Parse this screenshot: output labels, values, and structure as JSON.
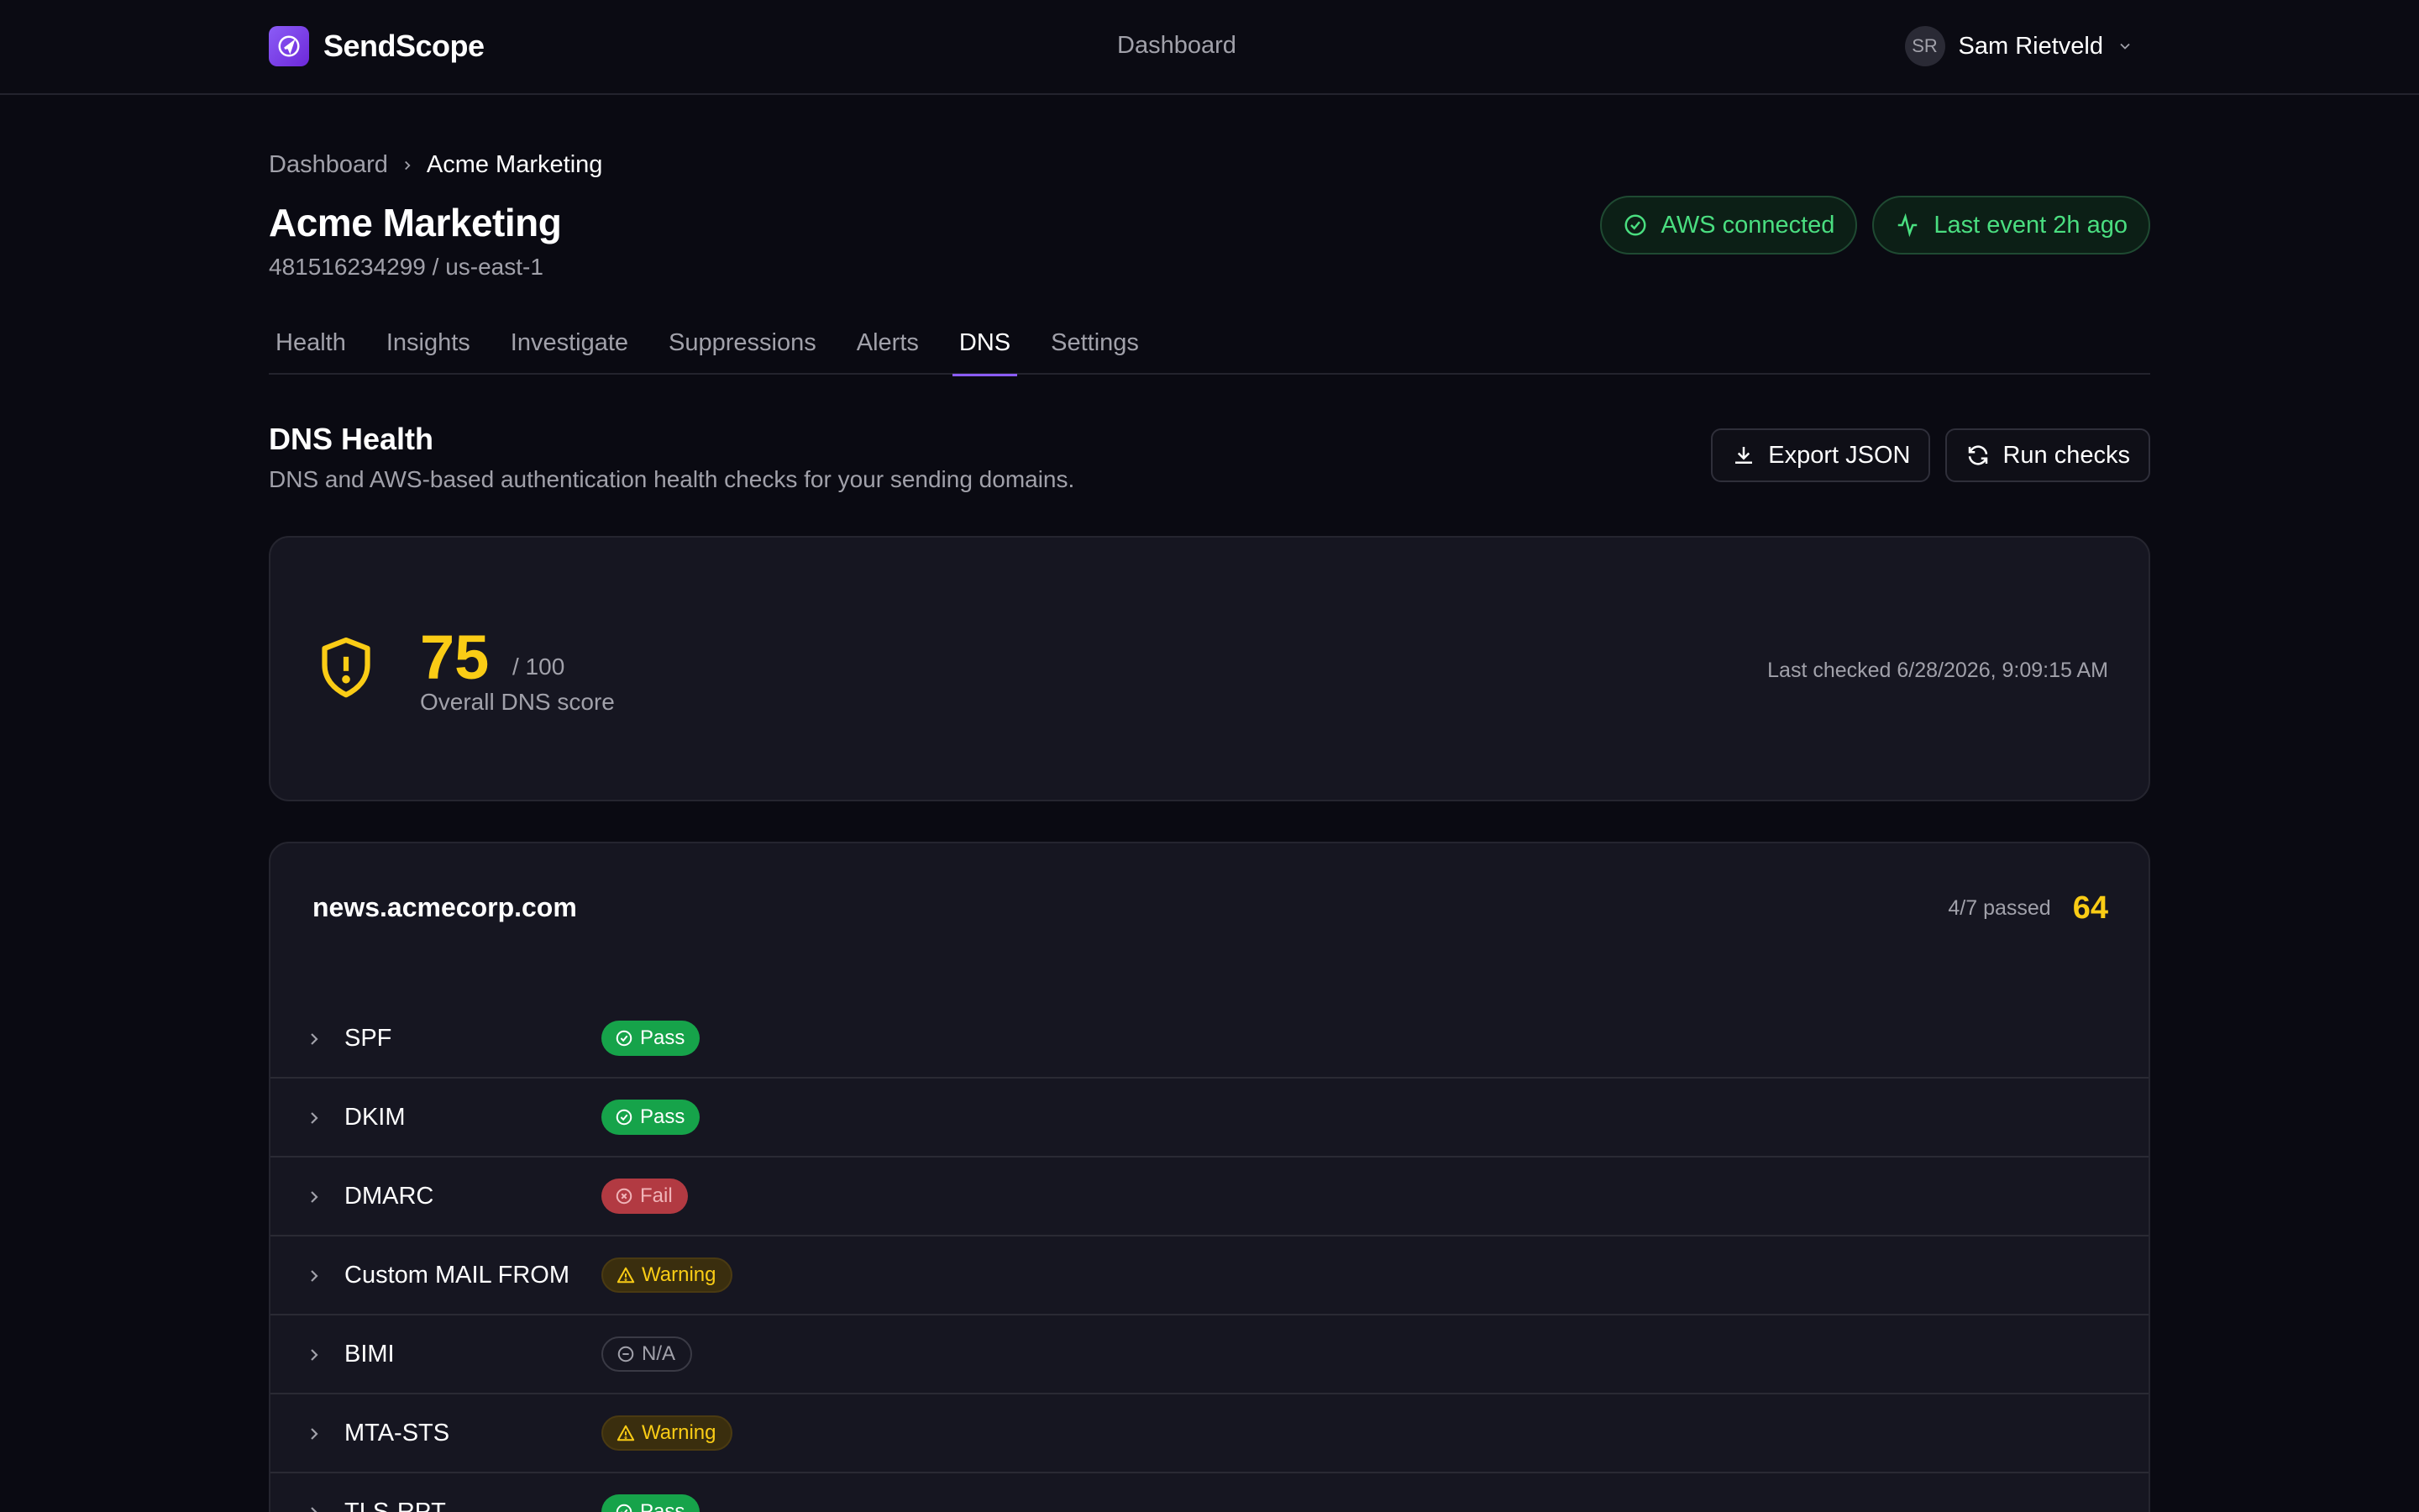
{
  "app": {
    "name": "SendScope",
    "nav_center": "Dashboard"
  },
  "user": {
    "initials": "SR",
    "name": "Sam Rietveld"
  },
  "breadcrumb": {
    "root": "Dashboard",
    "current": "Acme Marketing"
  },
  "account": {
    "title": "Acme Marketing",
    "subtitle": "481516234299 / us-east-1"
  },
  "badges": {
    "aws": "AWS connected",
    "last_event": "Last event 2h ago"
  },
  "tabs": [
    {
      "label": "Health"
    },
    {
      "label": "Insights"
    },
    {
      "label": "Investigate"
    },
    {
      "label": "Suppressions"
    },
    {
      "label": "Alerts"
    },
    {
      "label": "DNS",
      "active": true
    },
    {
      "label": "Settings"
    }
  ],
  "section": {
    "title": "DNS Health",
    "subtitle": "DNS and AWS-based authentication health checks for your sending domains.",
    "export_label": "Export JSON",
    "run_label": "Run checks"
  },
  "score": {
    "value": "75",
    "max": "/ 100",
    "label": "Overall DNS score",
    "last_checked": "Last checked 6/28/2026, 9:09:15 AM"
  },
  "domain": {
    "name": "news.acmecorp.com",
    "passed": "4/7 passed",
    "score": "64",
    "checks": [
      {
        "name": "SPF",
        "status": "Pass"
      },
      {
        "name": "DKIM",
        "status": "Pass"
      },
      {
        "name": "DMARC",
        "status": "Fail"
      },
      {
        "name": "Custom MAIL FROM",
        "status": "Warning"
      },
      {
        "name": "BIMI",
        "status": "N/A"
      },
      {
        "name": "MTA-STS",
        "status": "Warning"
      },
      {
        "name": "TLS-RPT",
        "status": "Pass"
      }
    ]
  },
  "colors": {
    "accent": "#8b5cf6",
    "pass": "#16a34a",
    "fail": "#b23a42",
    "warning": "#facc15",
    "connected": "#4ade80"
  }
}
